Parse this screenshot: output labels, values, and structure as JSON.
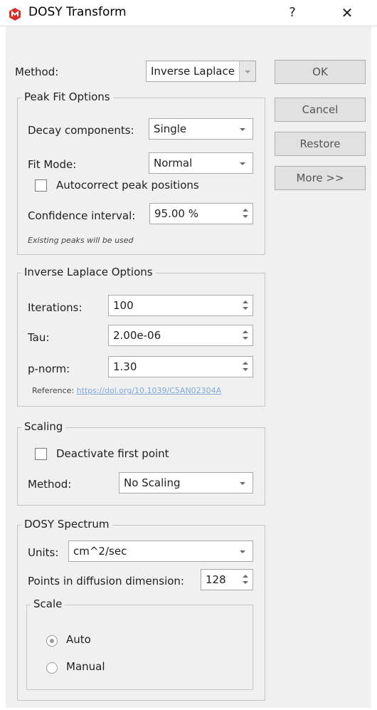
{
  "window": {
    "title": "DOSY Transform",
    "help_label": "?",
    "close_label": "✕",
    "icon": "app-logo-icon",
    "accent_color": "#d9302c"
  },
  "method": {
    "label": "Method:",
    "value": "Inverse Laplace"
  },
  "buttons": {
    "ok": "OK",
    "cancel": "Cancel",
    "restore": "Restore",
    "more": "More >>"
  },
  "peak_fit": {
    "title": "Peak Fit Options",
    "decay_label": "Decay components:",
    "decay_value": "Single",
    "fit_mode_label": "Fit Mode:",
    "fit_mode_value": "Normal",
    "autocorrect_label": "Autocorrect peak positions",
    "autocorrect_checked": false,
    "confidence_label": "Confidence interval:",
    "confidence_value": "95.00 %",
    "note": "Existing peaks will be used"
  },
  "inverse_laplace": {
    "title": "Inverse Laplace Options",
    "iterations_label": "Iterations:",
    "iterations_value": "100",
    "tau_label": "Tau:",
    "tau_value": "2.00e-06",
    "pnorm_label": "p-norm:",
    "pnorm_value": "1.30",
    "reference_label": "Reference:",
    "reference_link": "https://doi.org/10.1039/C5AN02304A"
  },
  "scaling": {
    "title": "Scaling",
    "deactivate_label": "Deactivate first point",
    "deactivate_checked": false,
    "method_label": "Method:",
    "method_value": "No Scaling"
  },
  "dosy_spectrum": {
    "title": "DOSY Spectrum",
    "units_label": "Units:",
    "units_value": "cm^2/sec",
    "points_label": "Points in diffusion dimension:",
    "points_value": "128",
    "scale": {
      "title": "Scale",
      "auto_label": "Auto",
      "manual_label": "Manual",
      "selected": "Auto"
    }
  }
}
